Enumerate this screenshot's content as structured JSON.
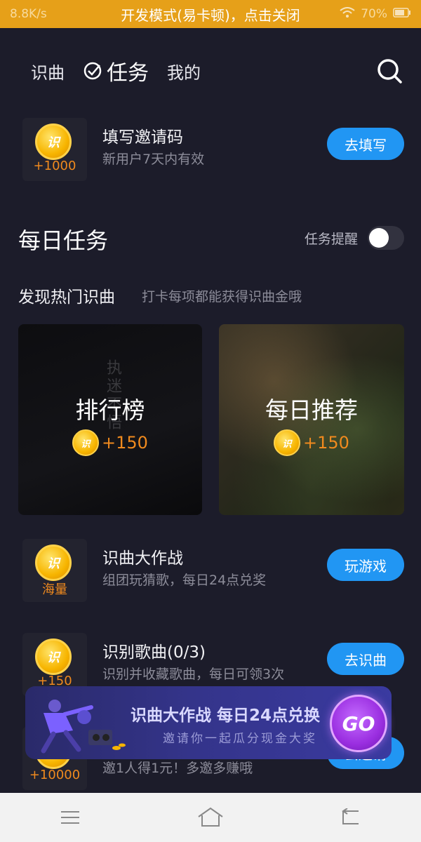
{
  "status_bar": {
    "left_text": "8.8K/s",
    "title": "开发模式(易卡顿)，点击关闭",
    "battery": "70%"
  },
  "nav": {
    "tabs": [
      {
        "label": "识曲"
      },
      {
        "label": "任务"
      },
      {
        "label": "我的"
      }
    ],
    "active_tab": "任务"
  },
  "invite_task": {
    "coin_label": "识",
    "amount": "+1000",
    "title": "填写邀请码",
    "desc": "新用户7天内有效",
    "button": "去填写"
  },
  "daily": {
    "title": "每日任务",
    "reminder_label": "任务提醒",
    "reminder_on": false
  },
  "discover": {
    "title": "发现热门识曲",
    "desc": "打卡每项都能获得识曲金哦",
    "cards": [
      {
        "title": "排行榜",
        "reward": "+150"
      },
      {
        "title": "每日推荐",
        "reward": "+150"
      }
    ]
  },
  "tasks": [
    {
      "coin_label": "识",
      "amount": "海量",
      "title": "识曲大作战",
      "desc": "组团玩猜歌，每日24点兑奖",
      "button": "玩游戏"
    },
    {
      "coin_label": "识",
      "amount": "+150",
      "title": "识别歌曲(0/3)",
      "desc": "识别并收藏歌曲，每日可领3次",
      "button": "去识曲"
    },
    {
      "coin_label": "识",
      "amount": "+10000",
      "title": "",
      "desc": "邀1人得1元！多邀多赚哦",
      "button": "去邀请"
    }
  ],
  "banner": {
    "title": "识曲大作战 每日24点兑换",
    "subtitle": "邀请你一起瓜分现金大奖",
    "go": "GO"
  },
  "colors": {
    "background": "#1c1c2a",
    "accent": "#2196f3",
    "coin_orange": "#f08a1e",
    "status_bar": "#e6a019"
  }
}
